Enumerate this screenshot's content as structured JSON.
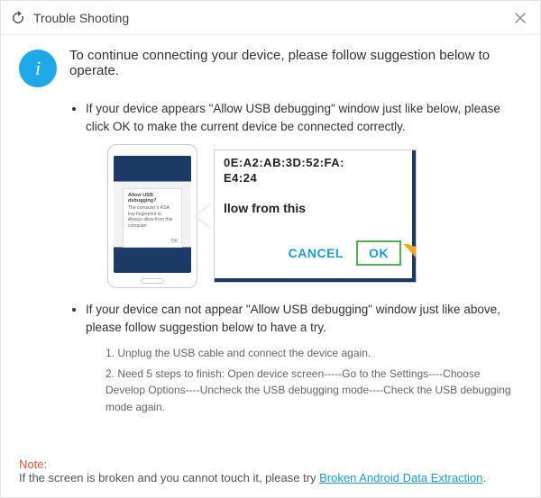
{
  "titlebar": {
    "title": "Trouble Shooting"
  },
  "lead": "To continue connecting your device, please follow suggestion below to operate.",
  "tip1": "If your device appears \"Allow USB debugging\" window just like below, please click OK to make the current device  be connected correctly.",
  "phone_dialog": {
    "title": "Allow USB debugging?",
    "body": "The computer's RSA key fingerprint is:",
    "always": "Always allow from this computer",
    "ok": "OK"
  },
  "zoom": {
    "mac1": "0E:A2:AB:3D:52:FA:",
    "mac2": "E4:24",
    "prompt": "llow from this",
    "cancel": "CANCEL",
    "ok": "OK"
  },
  "tip2": "If your device can not appear \"Allow USB debugging\" window just like above, please follow suggestion below to have a try.",
  "steps": {
    "s1": "1. Unplug the USB cable and connect the device again.",
    "s2": "2. Need 5 steps to finish: Open device screen-----Go to the Settings----Choose Develop Options----Uncheck the USB debugging mode----Check the USB debugging mode again."
  },
  "note": {
    "label": "Note:",
    "text_before": "If the screen is broken and you cannot touch it, please try ",
    "link": "Broken Android Data Extraction",
    "text_after": "."
  }
}
